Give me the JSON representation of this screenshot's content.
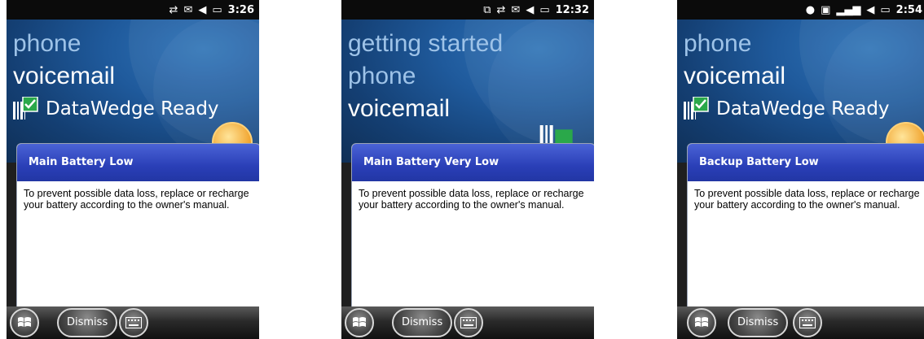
{
  "screens": [
    {
      "status": {
        "time": "3:26"
      },
      "home_items": [
        "phone",
        "voicemail"
      ],
      "datawedge_label": "DataWedge Ready",
      "notification": {
        "title": "Main Battery Low",
        "body": "To prevent possible data loss, replace or recharge your battery according to the owner's manual."
      },
      "softkeys": {
        "left_icon": "windows-start-icon",
        "center_label": "Dismiss",
        "right_icon": "keyboard-icon"
      }
    },
    {
      "status": {
        "time": "12:32"
      },
      "home_items": [
        "getting started",
        "phone",
        "voicemail"
      ],
      "notification": {
        "title": "Main Battery Very Low",
        "body": "To prevent possible data loss, replace or recharge your battery according to the owner's manual."
      },
      "softkeys": {
        "left_icon": "windows-start-icon",
        "center_label": "Dismiss",
        "right_icon": "keyboard-icon"
      }
    },
    {
      "status": {
        "time": "2:54"
      },
      "home_items": [
        "phone",
        "voicemail"
      ],
      "datawedge_label": "DataWedge Ready",
      "notification": {
        "title": "Backup Battery Low",
        "body": "To prevent possible data loss, replace or recharge your battery according to the owner's manual."
      },
      "softkeys": {
        "left_icon": "windows-start-icon",
        "center_label": "Dismiss",
        "right_icon": "keyboard-icon"
      }
    }
  ],
  "colors": {
    "title_bar_blue": "#2a3fb7",
    "home_bg_blue": "#1f5a9c",
    "inactive_item": "#9ec3e8"
  }
}
